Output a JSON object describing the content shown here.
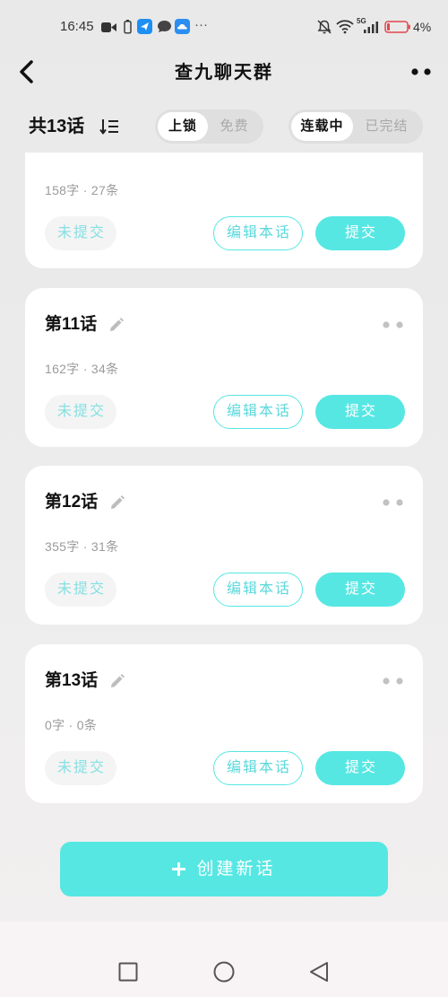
{
  "theme": {
    "accent": "#56e7e3",
    "accent_text": "#5cd8db",
    "page_bg_top": "#e9e9e9",
    "page_bg_bottom": "#f2efef",
    "battery_low": "#e0474c"
  },
  "status_bar": {
    "time": "16:45",
    "more": "···",
    "network": "5G",
    "battery": "4%",
    "icons": [
      "video-icon",
      "phone-icon",
      "navigation-app-icon",
      "chat-icon",
      "cloud-app-icon",
      "mute-icon",
      "wifi-icon",
      "signal-icon",
      "battery-icon"
    ]
  },
  "header": {
    "title": "查九聊天群",
    "icons": [
      "back-icon",
      "more-icon"
    ]
  },
  "toolbar": {
    "count_label": "共13话",
    "sort_icon": "sort-icon",
    "lock_filter": {
      "options": [
        "上锁",
        "免费"
      ],
      "selected": 0
    },
    "status_filter": {
      "options": [
        "连载中",
        "已完结"
      ],
      "selected": 0
    }
  },
  "episode_actions": {
    "edit_label": "编辑本话",
    "submit_label": "提交",
    "icons": [
      "pencil-icon",
      "more-icon"
    ]
  },
  "episodes": [
    {
      "meta": "158字 · 27条",
      "status": "未提交"
    },
    {
      "title": "第11话",
      "meta": "162字 · 34条",
      "status": "未提交"
    },
    {
      "title": "第12话",
      "meta": "355字 · 31条",
      "status": "未提交"
    },
    {
      "title": "第13话",
      "meta": "0字 · 0条",
      "status": "未提交"
    }
  ],
  "create_button": {
    "label": "创建新话",
    "icon": "plus-icon"
  },
  "system_nav": {
    "icons": [
      "recent-apps-icon",
      "home-icon",
      "back-icon"
    ]
  }
}
